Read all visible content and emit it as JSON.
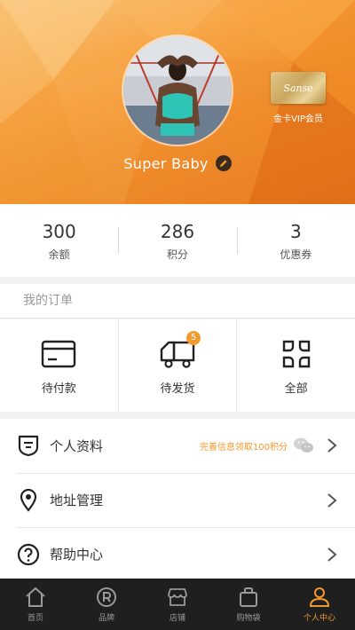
{
  "header": {
    "username": "Super Baby",
    "vip_card_text": "Sanse",
    "vip_label": "金卡VIP会员"
  },
  "stats": [
    {
      "value": "300",
      "label": "余额"
    },
    {
      "value": "286",
      "label": "积分"
    },
    {
      "value": "3",
      "label": "优惠券"
    }
  ],
  "orders": {
    "title": "我的订单",
    "items": [
      {
        "label": "待付款",
        "icon": "card-icon"
      },
      {
        "label": "待发货",
        "icon": "truck-icon",
        "badge": "5"
      },
      {
        "label": "全部",
        "icon": "grid-icon"
      }
    ]
  },
  "menu": [
    {
      "label": "个人资料",
      "icon": "profile-shield-icon",
      "hint": "完善信息领取100积分"
    },
    {
      "label": "地址管理",
      "icon": "location-pin-icon"
    },
    {
      "label": "帮助中心",
      "icon": "help-icon"
    }
  ],
  "tabbar": [
    {
      "label": "首页",
      "icon": "home-icon"
    },
    {
      "label": "品牌",
      "icon": "registered-icon"
    },
    {
      "label": "店铺",
      "icon": "store-icon"
    },
    {
      "label": "购物袋",
      "icon": "bag-icon"
    },
    {
      "label": "个人中心",
      "icon": "person-icon",
      "active": true
    }
  ],
  "colors": {
    "accent": "#f39a2f",
    "tabbar_bg": "#1f1f1f",
    "header_gradient_start": "#f9c47a",
    "header_gradient_end": "#e2731a"
  }
}
